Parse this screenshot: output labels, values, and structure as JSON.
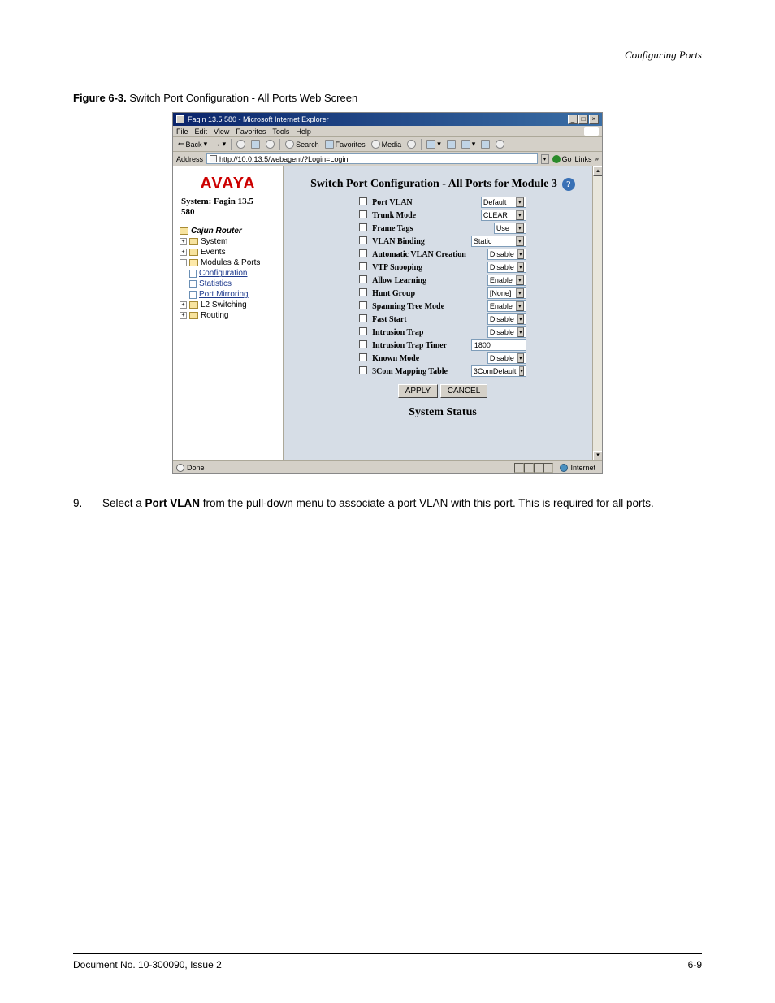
{
  "doc_header": "Configuring Ports",
  "figure_label_prefix": "Figure 6-3.",
  "figure_label_text": "Switch Port Configuration - All Ports Web Screen",
  "window": {
    "title": "Fagin 13.5 580 - Microsoft Internet Explorer",
    "min": "_",
    "max": "□",
    "close": "×"
  },
  "menubar": [
    "File",
    "Edit",
    "View",
    "Favorites",
    "Tools",
    "Help"
  ],
  "toolbar": {
    "back": "Back",
    "search": "Search",
    "favorites": "Favorites",
    "media": "Media"
  },
  "addressbar": {
    "label": "Address",
    "url": "http://10.0.13.5/webagent/?Login=Login",
    "go": "Go",
    "links": "Links"
  },
  "sidebar": {
    "logo": "AVAYA",
    "system_line1": "System: Fagin 13.5",
    "system_line2": "580",
    "cajun": "Cajun Router",
    "system_node": "System",
    "events_node": "Events",
    "modules_node": "Modules & Ports",
    "configuration": "Configuration",
    "statistics": "Statistics",
    "port_mirroring": "Port Mirroring",
    "l2_switching": "L2 Switching",
    "routing": "Routing"
  },
  "main": {
    "heading": "Switch Port Configuration - All Ports for Module 3",
    "help": "?",
    "rows": {
      "port_vlan": "Port VLAN",
      "trunk_mode": "Trunk Mode",
      "frame_tags": "Frame Tags",
      "vlan_binding": "VLAN Binding",
      "auto_vlan": "Automatic VLAN Creation",
      "vtp_snooping": "VTP Snooping",
      "allow_learning": "Allow Learning",
      "hunt_group": "Hunt Group",
      "stp_mode": "Spanning Tree Mode",
      "fast_start": "Fast Start",
      "intrusion_trap": "Intrusion Trap",
      "intrusion_timer": "Intrusion Trap Timer",
      "known_mode": "Known Mode",
      "mapping_table": "3Com Mapping Table"
    },
    "values": {
      "port_vlan": "Default",
      "trunk_mode": "CLEAR",
      "frame_tags": "Use",
      "vlan_binding": "Static",
      "auto_vlan": "Disable",
      "vtp_snooping": "Disable",
      "allow_learning": "Enable",
      "hunt_group": "[None]",
      "stp_mode": "Enable",
      "fast_start": "Disable",
      "intrusion_trap": "Disable",
      "intrusion_timer": "1800",
      "known_mode": "Disable",
      "mapping_table": "3ComDefault"
    },
    "buttons": {
      "apply": "APPLY",
      "cancel": "CANCEL"
    },
    "status_heading": "System Status"
  },
  "statusbar": {
    "done": "Done",
    "zone": "Internet"
  },
  "instruction": {
    "step": "9.",
    "text_part1": "Select a ",
    "text_bold": "Port VLAN",
    "text_part2": " from the pull-down menu to associate a port VLAN with this port. This is required for all ports."
  },
  "footer": {
    "left": "Document No. 10-300090, Issue 2",
    "right": "6-9"
  }
}
